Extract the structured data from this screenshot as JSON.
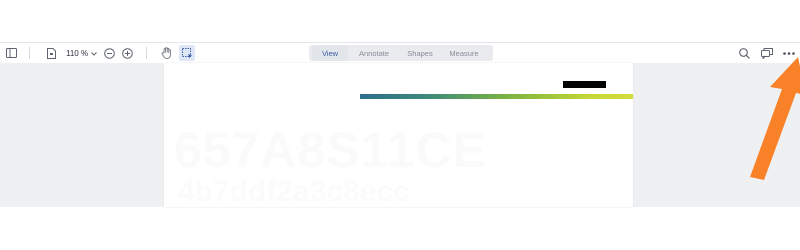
{
  "toolbar": {
    "zoom_value": "110 %",
    "tabs": [
      {
        "label": "View",
        "active": true
      },
      {
        "label": "Annotate",
        "active": false
      },
      {
        "label": "Shapes",
        "active": false
      },
      {
        "label": "Measure",
        "active": false
      }
    ],
    "icons": {
      "sidebar": "sidebar-toggle-icon",
      "page": "page-icon",
      "zoom_out": "zoom-out-icon",
      "zoom_in": "zoom-in-icon",
      "pan": "hand-pan-icon",
      "select": "area-select-icon",
      "search": "search-icon",
      "comments": "comments-icon",
      "more": "more-options-icon"
    }
  },
  "document": {
    "ghost_line_1": "657A8S11CE",
    "ghost_line_2": "4b7ddf2a3c8ecc"
  },
  "colors": {
    "accent": "#3a5fa6",
    "gradient_start": "#2e6f8c",
    "gradient_end": "#d3dc3a",
    "arrow": "#f98128"
  }
}
